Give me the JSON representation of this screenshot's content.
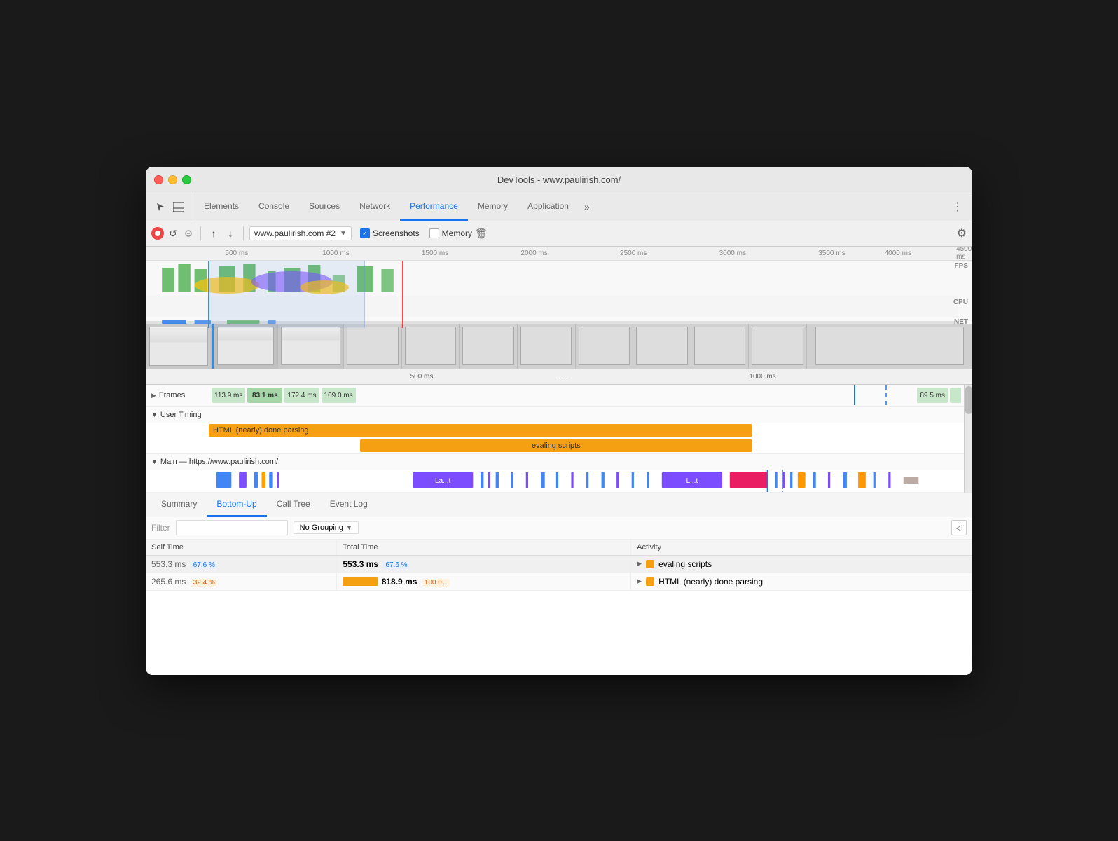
{
  "window": {
    "title": "DevTools - www.paulirish.com/"
  },
  "tabs": {
    "items": [
      {
        "label": "Elements",
        "active": false
      },
      {
        "label": "Console",
        "active": false
      },
      {
        "label": "Sources",
        "active": false
      },
      {
        "label": "Network",
        "active": false
      },
      {
        "label": "Performance",
        "active": true
      },
      {
        "label": "Memory",
        "active": false
      },
      {
        "label": "Application",
        "active": false
      }
    ],
    "more_label": "»",
    "menu_label": "⋮"
  },
  "toolbar": {
    "record_tooltip": "Record",
    "refresh_tooltip": "Reload and record",
    "stop_tooltip": "Stop",
    "upload_tooltip": "Load profile",
    "download_tooltip": "Save profile",
    "url_value": "www.paulirish.com #2",
    "screenshots_label": "Screenshots",
    "screenshots_checked": true,
    "memory_label": "Memory",
    "memory_checked": false,
    "clear_tooltip": "Clear",
    "settings_tooltip": "Settings"
  },
  "timeline": {
    "ruler_ticks": [
      "500 ms",
      "1000 ms",
      "1500 ms",
      "2000 ms",
      "2500 ms",
      "3000 ms",
      "3500 ms",
      "4000 ms",
      "4500 ms"
    ],
    "bottom_ruler_ticks": [
      "500 ms",
      "1000 ms"
    ],
    "fps_label": "FPS",
    "cpu_label": "CPU",
    "net_label": "NET",
    "three_dots": "..."
  },
  "frames": {
    "label": "Frames",
    "blocks": [
      {
        "duration": "113.9 ms",
        "type": "green"
      },
      {
        "duration": "83.1 ms",
        "type": "green-selected"
      },
      {
        "duration": "172.4 ms",
        "type": "green"
      },
      {
        "duration": "109.0 ms",
        "type": "green"
      },
      {
        "duration": "89.5 ms",
        "type": "green"
      }
    ]
  },
  "user_timing": {
    "label": "User Timing",
    "bars": [
      {
        "label": "HTML (nearly) done parsing",
        "color": "orange"
      },
      {
        "label": "evaling scripts",
        "color": "orange"
      }
    ]
  },
  "main_thread": {
    "label": "Main",
    "url": "https://www.paulirish.com/",
    "blocks": [
      {
        "label": "La...t",
        "color": "#7c4dff",
        "left": "28%",
        "width": "8%"
      },
      {
        "label": "L...t",
        "color": "#7c4dff",
        "left": "60%",
        "width": "8%"
      },
      {
        "label": "",
        "color": "#e91e63",
        "left": "70%",
        "width": "6%"
      }
    ]
  },
  "bottom_tabs": {
    "items": [
      {
        "label": "Summary",
        "active": false
      },
      {
        "label": "Bottom-Up",
        "active": true
      },
      {
        "label": "Call Tree",
        "active": false
      },
      {
        "label": "Event Log",
        "active": false
      }
    ]
  },
  "filter": {
    "label": "Filter",
    "placeholder": "",
    "grouping_label": "No Grouping"
  },
  "table": {
    "headers": [
      "Self Time",
      "Total Time",
      "Activity"
    ],
    "rows": [
      {
        "self_time": "553.3 ms",
        "self_pct": "67.6 %",
        "total_time": "553.3 ms",
        "total_pct": "67.6 %",
        "activity": "evaling scripts",
        "color": "orange",
        "has_bar": false
      },
      {
        "self_time": "265.6 ms",
        "self_pct": "32.4 %",
        "total_time": "818.9 ms",
        "total_pct": "100.0...",
        "activity": "HTML (nearly) done parsing",
        "color": "orange",
        "has_bar": true
      }
    ]
  }
}
